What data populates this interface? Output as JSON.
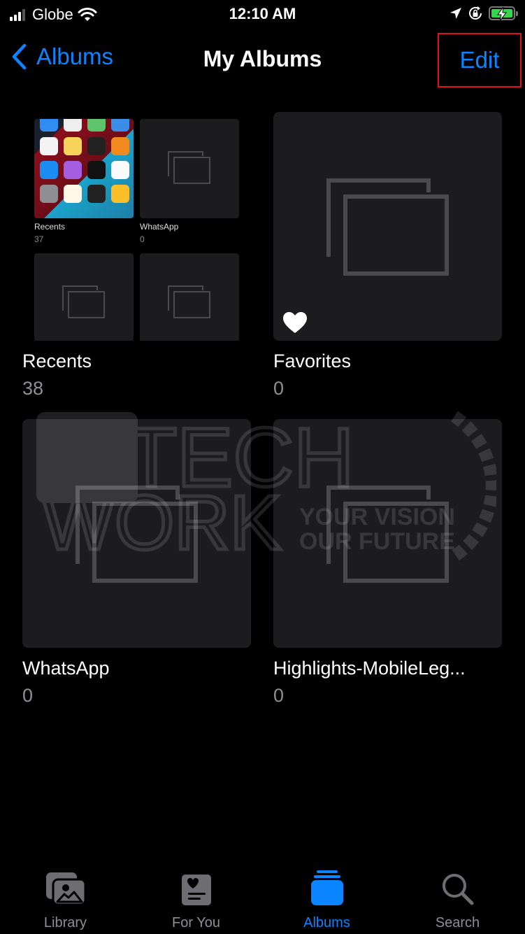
{
  "status_bar": {
    "carrier": "Globe",
    "time": "12:10 AM",
    "icons": [
      "signal-icon",
      "wifi-icon",
      "location-icon",
      "rotation-lock-icon",
      "battery-charging-icon"
    ]
  },
  "nav": {
    "back_label": "Albums",
    "title": "My Albums",
    "edit_label": "Edit",
    "highlight_color": "#e0111a"
  },
  "albums": [
    {
      "title": "Recents",
      "count": "38",
      "thumbnail": "recents-mosaic",
      "mosaic": [
        {
          "title": "Recents",
          "count": "37"
        },
        {
          "title": "WhatsApp",
          "count": "0"
        }
      ]
    },
    {
      "title": "Favorites",
      "count": "0",
      "thumbnail": "placeholder",
      "badge_icon": "heart-icon"
    },
    {
      "title": "WhatsApp",
      "count": "0",
      "thumbnail": "placeholder"
    },
    {
      "title": "Highlights-MobileLeg...",
      "count": "0",
      "thumbnail": "placeholder"
    }
  ],
  "watermark": {
    "line1": "HITECH",
    "line2": "WORK",
    "tagline1": "YOUR VISION",
    "tagline2": "OUR FUTURE"
  },
  "tab_bar": {
    "active_color": "#0a84ff",
    "inactive_color": "#8e8e93",
    "tabs": [
      {
        "label": "Library",
        "icon": "library-icon",
        "active": false
      },
      {
        "label": "For You",
        "icon": "for-you-icon",
        "active": false
      },
      {
        "label": "Albums",
        "icon": "albums-icon",
        "active": true
      },
      {
        "label": "Search",
        "icon": "search-icon",
        "active": false
      }
    ]
  }
}
